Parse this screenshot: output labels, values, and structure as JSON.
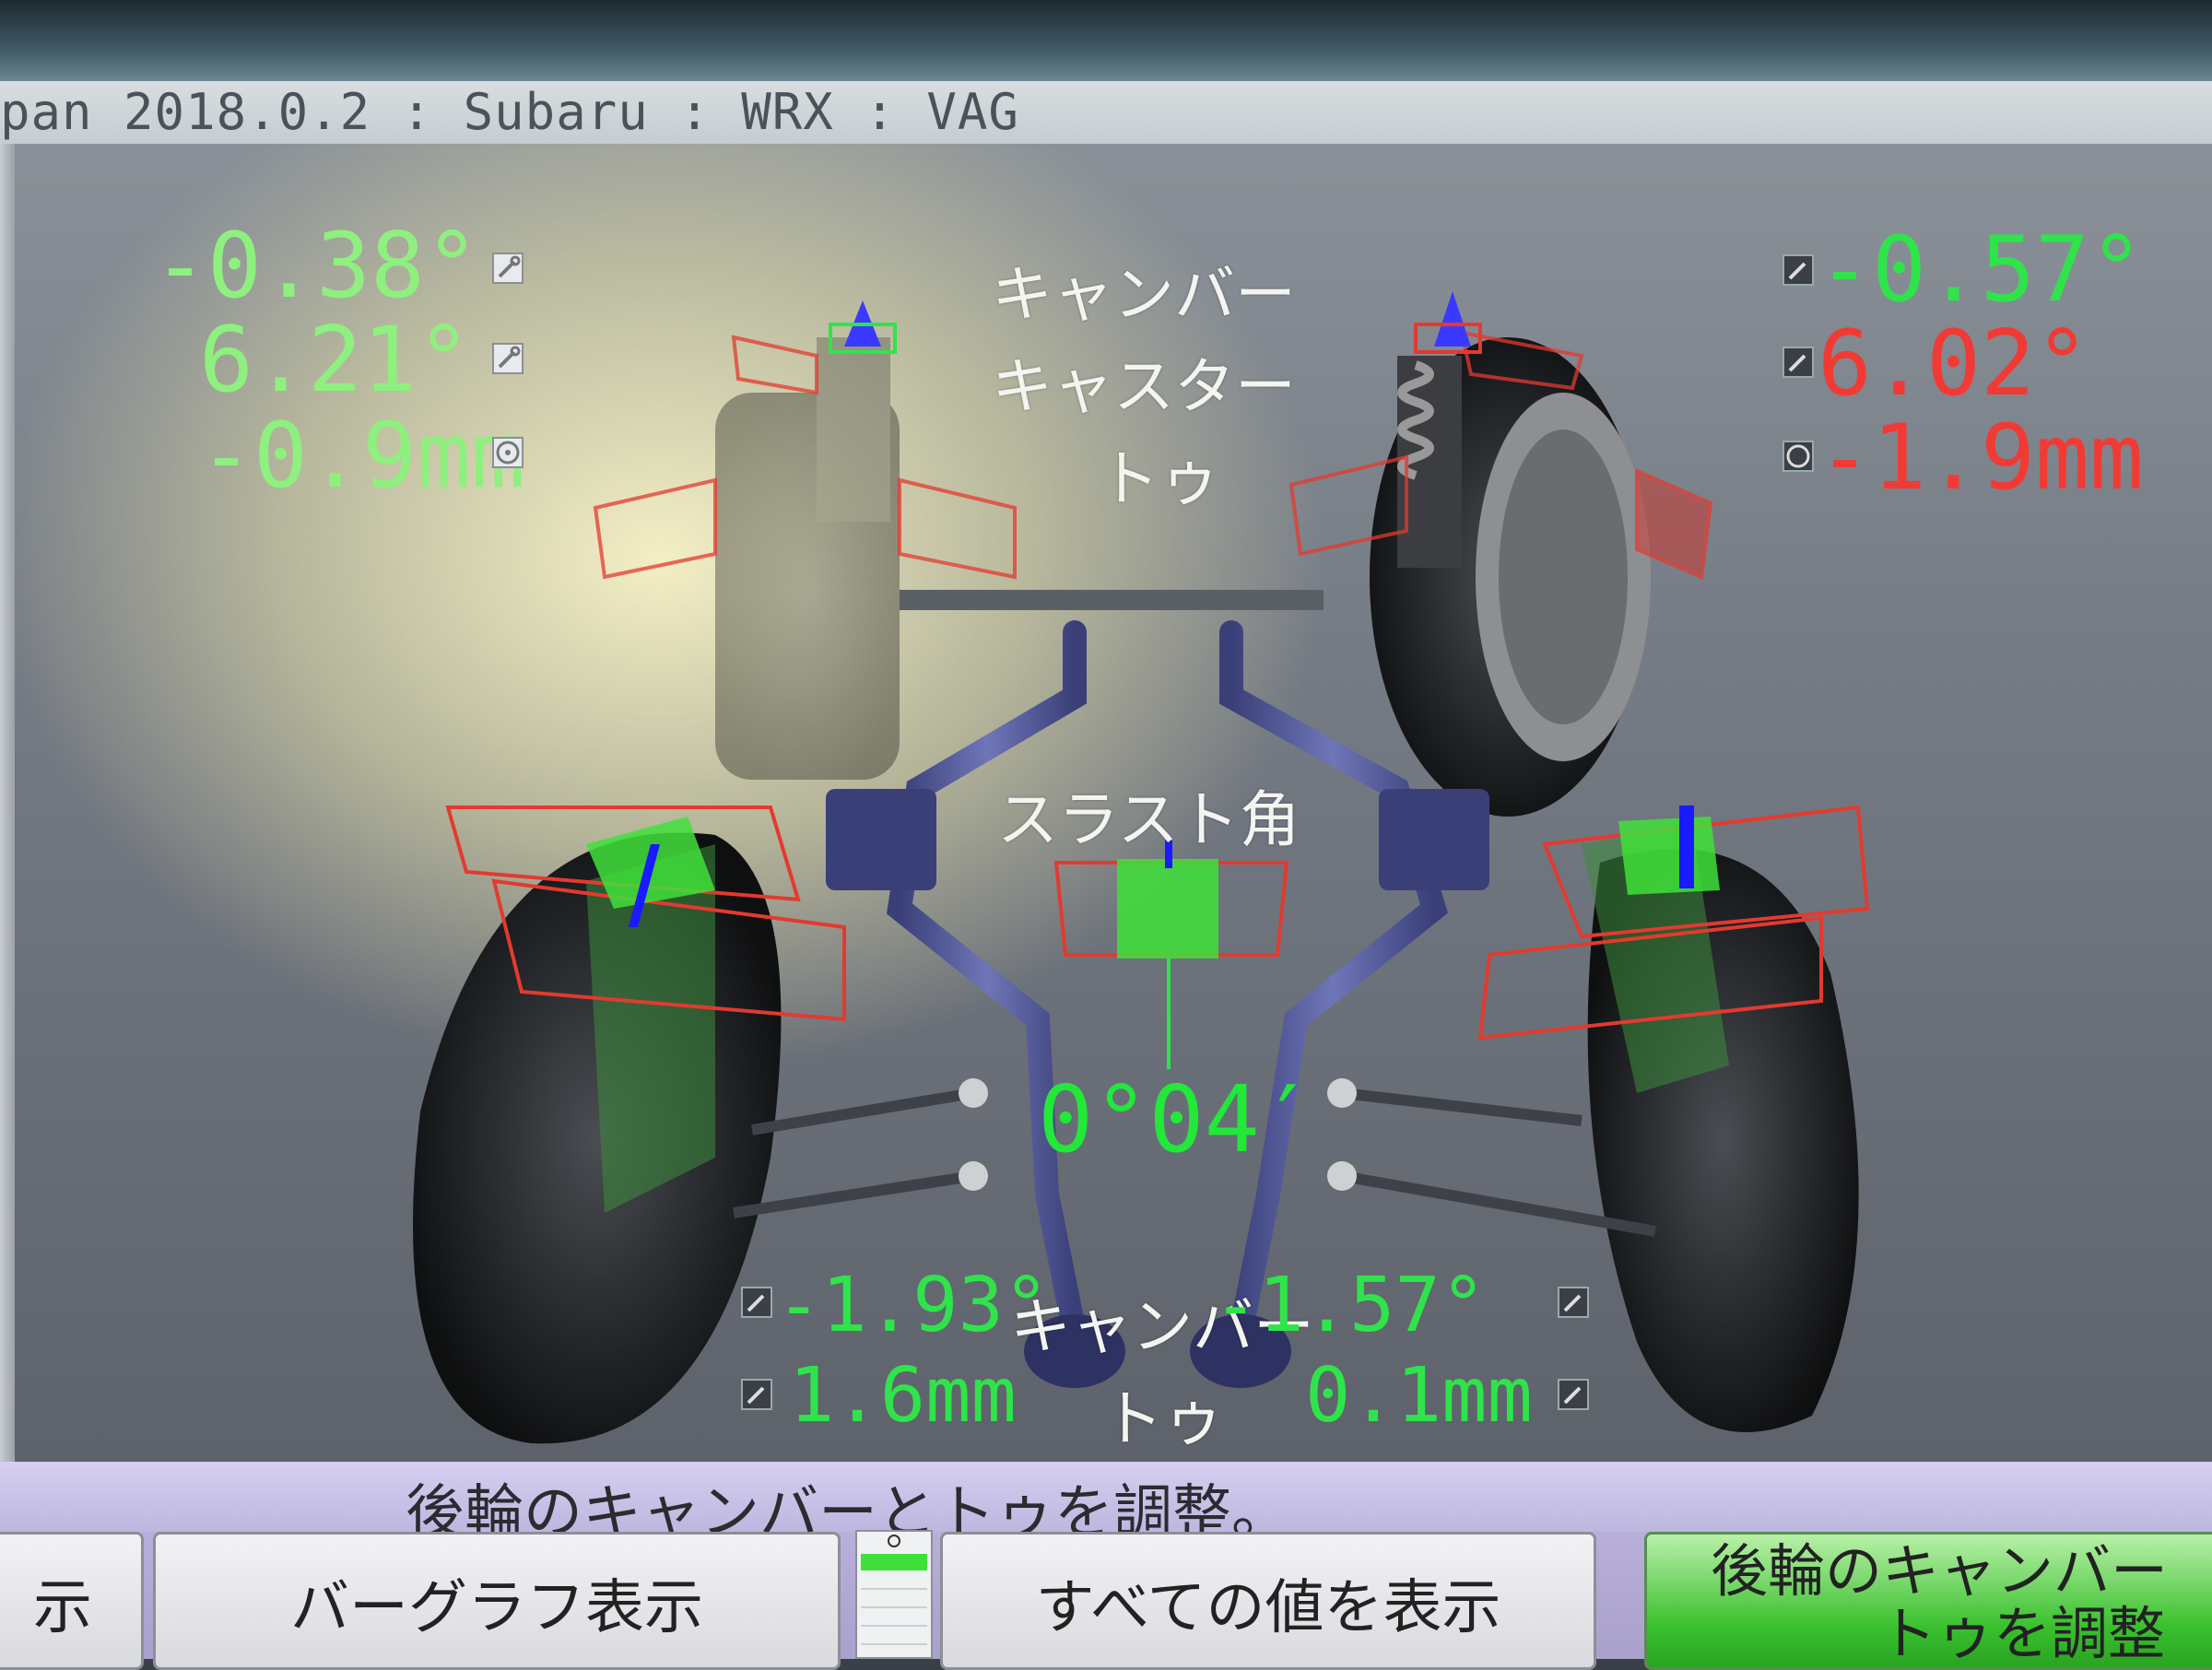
{
  "window": {
    "title": "pan 2018.0.2 : Subaru : WRX : VAG"
  },
  "front": {
    "left": {
      "camber": "-0.38°",
      "caster": "6.21°",
      "toe": "-0.9mm"
    },
    "right": {
      "camber": "-0.57°",
      "caster": "6.02°",
      "toe": "-1.9mm"
    },
    "labels": {
      "camber": "キャンバー",
      "caster": "キャスター",
      "toe": "トゥ"
    }
  },
  "thrust": {
    "label": "スラスト角",
    "value": "0°04′"
  },
  "rear": {
    "left": {
      "camber": "-1.93°",
      "toe": "1.6mm"
    },
    "right": {
      "camber": "-1.57°",
      "toe": "0.1mm"
    },
    "labels": {
      "camber": "キャンバー",
      "toe": "トゥ"
    }
  },
  "status": {
    "message": "後輪のキャンバーとトゥを調整。"
  },
  "buttons": {
    "left_partial": "示",
    "bar_graph": "バーグラフ表示",
    "show_all": "すべての値を表示",
    "adjust_rear_line1": "後輪のキャンバー",
    "adjust_rear_line2": "トゥを調整"
  },
  "colors": {
    "in_spec": "#2fe44a",
    "out_of_spec": "#f23a35",
    "active_button": "#39c02e"
  },
  "icons": {
    "adjust": "wrench-icon",
    "toe": "steering-wheel-icon"
  }
}
